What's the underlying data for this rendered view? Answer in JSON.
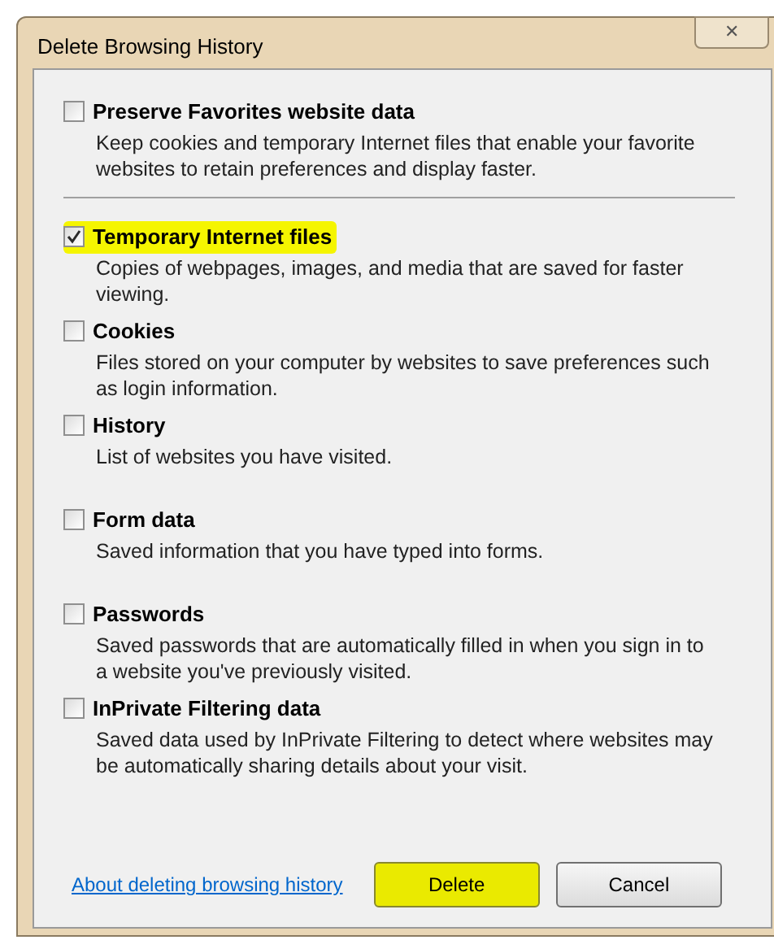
{
  "window": {
    "title": "Delete Browsing History",
    "close_symbol": "✕"
  },
  "options": [
    {
      "label": "Preserve Favorites website data",
      "description": "Keep cookies and temporary Internet files that enable your favorite websites to retain preferences and display faster.",
      "checked": false,
      "highlighted": false,
      "separator_after": true
    },
    {
      "label": "Temporary Internet files",
      "description": "Copies of webpages, images, and media that are saved for faster viewing.",
      "checked": true,
      "highlighted": true,
      "separator_after": false
    },
    {
      "label": "Cookies",
      "description": "Files stored on your computer by websites to save preferences such as login information.",
      "checked": false,
      "highlighted": false,
      "separator_after": false
    },
    {
      "label": "History",
      "description": "List of websites you have visited.",
      "checked": false,
      "highlighted": false,
      "separator_after": false
    },
    {
      "label": "Form data",
      "description": "Saved information that you have typed into forms.",
      "checked": false,
      "highlighted": false,
      "separator_after": false
    },
    {
      "label": "Passwords",
      "description": "Saved passwords that are automatically filled in when you sign in to a website you've previously visited.",
      "checked": false,
      "highlighted": false,
      "separator_after": false
    },
    {
      "label": "InPrivate Filtering data",
      "description": "Saved data used by InPrivate Filtering to detect where websites may be automatically sharing details about your visit.",
      "checked": false,
      "highlighted": false,
      "separator_after": false
    }
  ],
  "footer": {
    "link": "About deleting browsing history",
    "buttons": [
      {
        "label": "Delete",
        "highlighted": true
      },
      {
        "label": "Cancel",
        "highlighted": false
      }
    ]
  }
}
